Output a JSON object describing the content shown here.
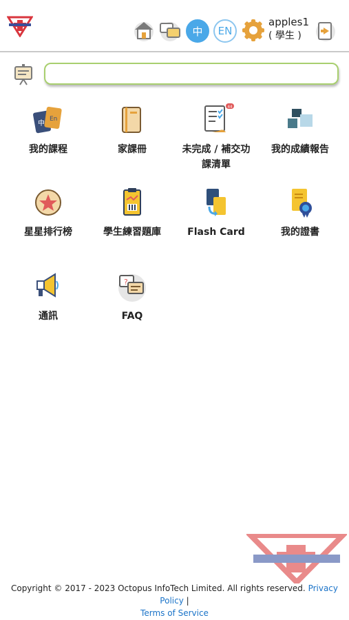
{
  "header": {
    "lang_zh": "中",
    "lang_en": "EN",
    "username": "apples1",
    "role": "( 學生 )",
    "icons": [
      "logo-icon",
      "home-icon",
      "chat-icon",
      "settings-gear-icon",
      "logout-icon"
    ]
  },
  "search": {
    "placeholder": "",
    "value": ""
  },
  "menu": [
    {
      "label": "我的課程",
      "icon": "books-icon"
    },
    {
      "label": "家課冊",
      "icon": "notebook-icon"
    },
    {
      "label": "未完成 / 補交功\n課清單",
      "icon": "checklist-icon",
      "badge": "44"
    },
    {
      "label": "我的成績報告",
      "icon": "report-blocks-icon"
    },
    {
      "label": "星星排行榜",
      "icon": "star-icon"
    },
    {
      "label": "學生練習題庫",
      "icon": "question-bank-icon"
    },
    {
      "label": "Flash Card",
      "icon": "flash-card-icon"
    },
    {
      "label": "我的證書",
      "icon": "certificate-icon"
    },
    {
      "label": "通訊",
      "icon": "megaphone-icon"
    },
    {
      "label": "FAQ",
      "icon": "faq-chat-icon"
    }
  ],
  "footer": {
    "copyright": "Copyright © 2017 - 2023 Octopus InfoTech Limited. All rights reserved.",
    "privacy": "Privacy Policy",
    "separator": "|",
    "terms": "Terms of Service"
  },
  "colors": {
    "accent_blue": "#4aa8e8",
    "search_border": "#a8cf6e",
    "link": "#1a73c8"
  }
}
